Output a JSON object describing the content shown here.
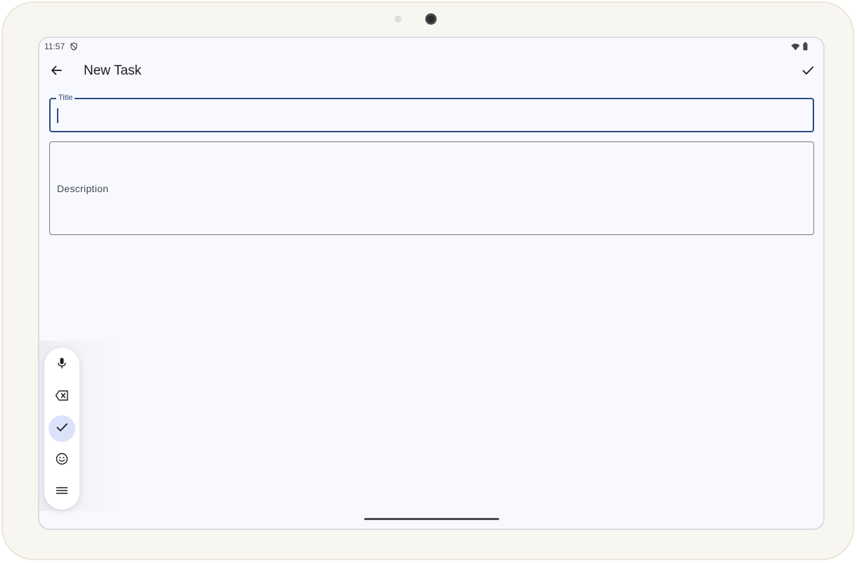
{
  "status_bar": {
    "time": "11:57",
    "left_icons": [
      "do-not-disturb-icon"
    ],
    "right_icons": [
      "wifi-icon",
      "battery-icon"
    ]
  },
  "app_bar": {
    "title": "New Task",
    "back_icon": "arrow-back-icon",
    "save_icon": "check-icon"
  },
  "form": {
    "title_field": {
      "label": "Title",
      "value": ""
    },
    "description_field": {
      "placeholder": "Description",
      "value": ""
    }
  },
  "floating_toolbar": {
    "items": [
      {
        "icon": "microphone-icon"
      },
      {
        "icon": "backspace-icon"
      },
      {
        "icon": "check-icon",
        "active": true
      },
      {
        "icon": "emoji-icon"
      },
      {
        "icon": "menu-icon"
      }
    ]
  },
  "colors": {
    "background": "#f8f9ff",
    "focused_outline": "#2c4b82",
    "outline": "#767780",
    "active_toolbar_item": "#dce2fa",
    "device_frame": "#f7f6f1"
  }
}
